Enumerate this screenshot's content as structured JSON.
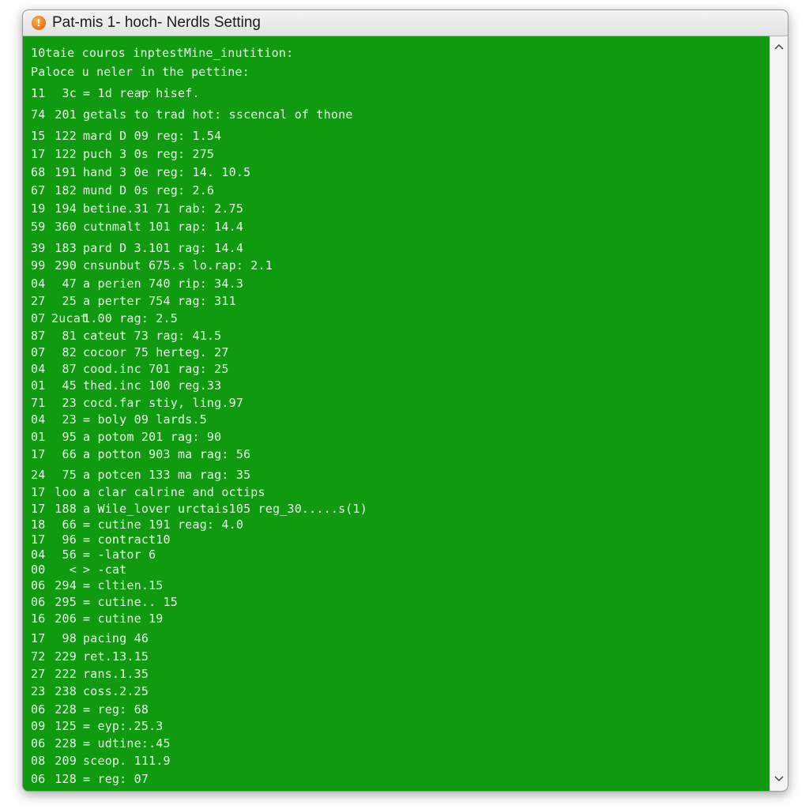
{
  "window": {
    "title": "Pat-mis 1- hoch- Nerdls Setting",
    "icon": "warning-app-icon",
    "accent": "#0f9a0f"
  },
  "console": {
    "header_line_1": "10taie couros inptestMine_inutition:",
    "header_line_2": "Paloce u neler in the pettine:",
    "dots": "....",
    "lines": [
      {
        "n": "11",
        "s": "3c",
        "t": "= 1d reap hisef."
      },
      {
        "n": "74",
        "s": "201",
        "t": "getals to trad hot: sscencal of thone"
      },
      {
        "n": "15",
        "s": "122",
        "t": "mard D 09 reg: 1.54"
      },
      {
        "n": "17",
        "s": "122",
        "t": "puch 3 0s reg: 275"
      },
      {
        "n": "68",
        "s": "191",
        "t": "hand 3 0e reg: 14. 10.5"
      },
      {
        "n": "67",
        "s": "182",
        "t": "mund D 0s reg: 2.6"
      },
      {
        "n": "19",
        "s": "194",
        "t": "betine.31 71 rab: 2.75"
      },
      {
        "n": "59",
        "s": "360",
        "t": "cutnmalt 101 rap: 14.4"
      },
      {
        "n": "39",
        "s": "183",
        "t": "pard D 3.101 rag: 14.4"
      },
      {
        "n": "99",
        "s": "290",
        "t": "cnsunbut 675.s lo.rap: 2.1"
      },
      {
        "n": "04",
        "s": "47",
        "t": "a perien 740 rip: 34.3"
      },
      {
        "n": "27",
        "s": "25",
        "t": "a perter 754 rag: 311"
      },
      {
        "n": "07",
        "s": "2ucat",
        "t": "1.00 rag: 2.5"
      },
      {
        "n": "87",
        "s": "81",
        "t": "cateut 73 rag: 41.5"
      },
      {
        "n": "07",
        "s": "82",
        "t": "cocoor 75 herteg. 27"
      },
      {
        "n": "04",
        "s": "87",
        "t": "cood.inc 701 rag: 25"
      },
      {
        "n": "01",
        "s": "45",
        "t": "thed.inc 100 reg.33"
      },
      {
        "n": "71",
        "s": "23",
        "t": "cocd.far stiy, ling.97"
      },
      {
        "n": "04",
        "s": "23",
        "t": "= boly 09 lards.5"
      },
      {
        "n": "01",
        "s": "95",
        "t": "a potom 201 rag: 90"
      },
      {
        "n": "17",
        "s": "66",
        "t": "a potton 903 ma rag: 56"
      },
      {
        "n": "24",
        "s": "75",
        "t": "a potcen 133 ma rag: 35"
      },
      {
        "n": "17",
        "s": "loo",
        "t": "a clar calrine and octips"
      },
      {
        "n": "17",
        "s": "188",
        "t": "a Wile_lover urctais105 reg_30.....s(1)"
      },
      {
        "n": "18",
        "s": "66",
        "t": "= cutine 191 reag: 4.0"
      },
      {
        "n": "17",
        "s": "96",
        "t": "= contract10"
      },
      {
        "n": "04",
        "s": "56",
        "t": "= -lator 6"
      },
      {
        "n": "00",
        "s": "<",
        "t": "> -cat"
      },
      {
        "n": "06",
        "s": "294",
        "t": "= cltien.15"
      },
      {
        "n": "06",
        "s": "295",
        "t": "= cutine.. 15"
      },
      {
        "n": "16",
        "s": "206",
        "t": "= cutine 19"
      },
      {
        "n": "17",
        "s": "98",
        "t": "pacing 46"
      },
      {
        "n": "72",
        "s": "229",
        "t": "ret.13.15"
      },
      {
        "n": "27",
        "s": "222",
        "t": "rans.1.35"
      },
      {
        "n": "23",
        "s": "238",
        "t": "coss.2.25"
      },
      {
        "n": "06",
        "s": "228",
        "t": "= reg: 68"
      },
      {
        "n": "09",
        "s": "125",
        "t": "= eyp:.25.3"
      },
      {
        "n": "06",
        "s": "228",
        "t": "= udtine:.45"
      },
      {
        "n": "08",
        "s": "209",
        "t": "sceop. 111.9"
      },
      {
        "n": "06",
        "s": "128",
        "t": "= reg: 07"
      }
    ]
  },
  "scrollbar": {
    "up_icon": "chevron-up-icon",
    "down_icon": "chevron-down-icon"
  }
}
